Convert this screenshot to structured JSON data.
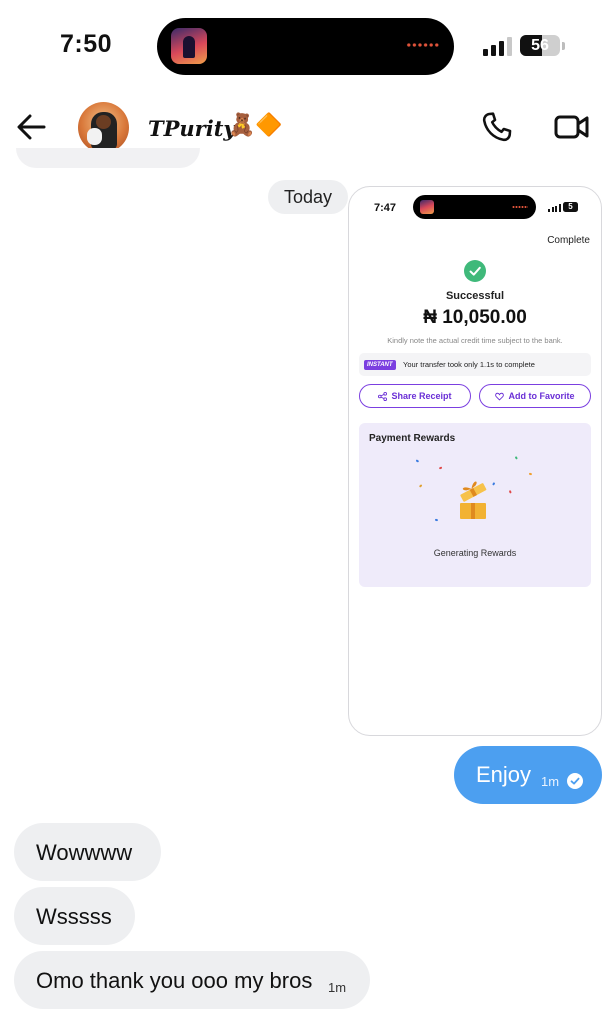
{
  "status_bar": {
    "time": "7:50",
    "battery_level": "56",
    "battery_fraction": 0.56
  },
  "header": {
    "contact_name": "TPurity",
    "name_emoji": "🧸🔶",
    "icons": {
      "back": "back-arrow-icon",
      "call": "phone-icon",
      "video": "video-camera-icon"
    }
  },
  "date_separator": "Today",
  "screenshot": {
    "time": "7:47",
    "battery": "5",
    "complete_label": "Complete",
    "status": "Successful",
    "amount": "₦ 10,050.00",
    "note": "Kindly note the actual credit time subject to the bank.",
    "instant_badge": "INSTANT",
    "instant_text": "Your transfer took only 1.1s to complete",
    "share_label": "Share Receipt",
    "favorite_label": "Add to Favorite",
    "rewards_title": "Payment Rewards",
    "rewards_status": "Generating Rewards",
    "accent_color": "#7b3fe0",
    "success_color": "#3fb97a"
  },
  "messages": {
    "outgoing": [
      {
        "text": "Enjoy",
        "time": "1m",
        "read": true
      }
    ],
    "incoming": [
      {
        "text": "Wowwww",
        "time": ""
      },
      {
        "text": "Wsssss",
        "time": ""
      },
      {
        "text": "Omo thank you ooo my bros",
        "time": "1m"
      }
    ]
  },
  "colors": {
    "outgoing_bubble": "#4c9ff0",
    "incoming_bubble": "#eeeff1"
  }
}
